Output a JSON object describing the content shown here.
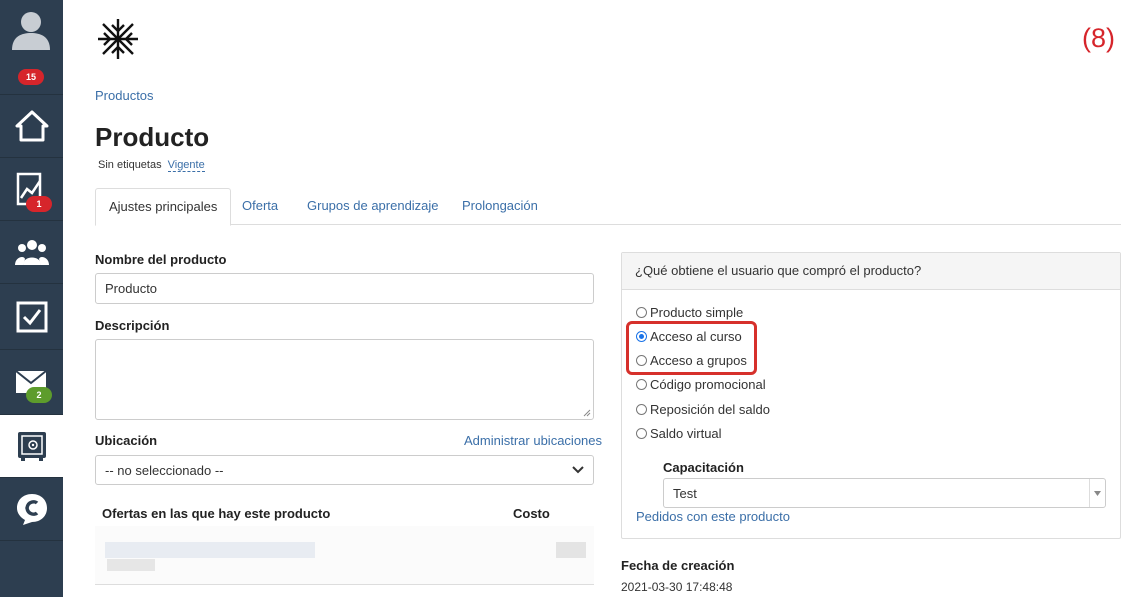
{
  "sidebar": {
    "notifications_badge": "15",
    "stats_badge": "1",
    "messages_badge": "2"
  },
  "header": {
    "breadcrumb": "Productos",
    "title": "Producto",
    "tags_label": "Sin etiquetas",
    "status": "Vigente",
    "counter": "(8)"
  },
  "tabs": [
    {
      "label": "Ajustes principales"
    },
    {
      "label": "Oferta"
    },
    {
      "label": "Grupos de aprendizaje"
    },
    {
      "label": "Prolongación"
    }
  ],
  "form": {
    "name_label": "Nombre del producto",
    "name_value": "Producto",
    "description_label": "Descripción",
    "location_label": "Ubicación",
    "manage_locations": "Administrar ubicaciones",
    "location_value": "-- no seleccionado --",
    "offers_col": "Ofertas en las que hay este producto",
    "cost_col": "Costo"
  },
  "panel": {
    "question": "¿Qué obtiene el usuario que compró el producto?",
    "options": [
      {
        "label": "Producto simple",
        "checked": false
      },
      {
        "label": "Acceso al curso",
        "checked": true
      },
      {
        "label": "Acceso a grupos",
        "checked": false
      },
      {
        "label": "Código promocional",
        "checked": false
      },
      {
        "label": "Reposición del saldo",
        "checked": false
      },
      {
        "label": "Saldo virtual",
        "checked": false
      }
    ],
    "training_label": "Capacitación",
    "training_value": "Test",
    "orders_link": "Pedidos con este producto"
  },
  "meta": {
    "created_label": "Fecha de creación",
    "created_value": "2021-03-30 17:48:48"
  },
  "colors": {
    "sidebar_bg": "#2d3e50",
    "link": "#3b6fa8",
    "highlight": "#d6302b"
  }
}
